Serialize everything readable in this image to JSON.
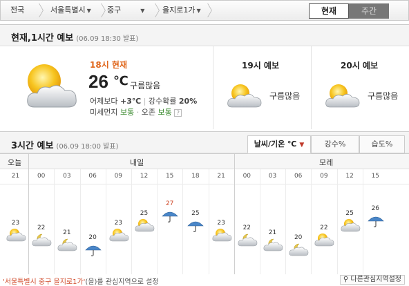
{
  "nav": {
    "country": "전국",
    "city": "서울특별시",
    "district": "중구",
    "dong": "을지로1가",
    "tab_now": "현재",
    "tab_week": "주간"
  },
  "now_section": {
    "title": "현재,1시간 예보",
    "timestamp": "(06.09 18:30 발표)",
    "current": {
      "label": "18시 현재",
      "temp": "26",
      "unit": "℃",
      "condition": "구름많음",
      "compare_label": "어제보다",
      "compare_value": "+3℃",
      "precip_label": "강수확률",
      "precip_value": "20%",
      "dust_label": "미세먼지",
      "dust_value": "보통",
      "ozone_label": "오존",
      "ozone_value": "보통",
      "help": "?"
    },
    "forecasts": [
      {
        "title": "19시 예보",
        "condition": "구름많음",
        "icon": "partly-cloudy-sun-icon"
      },
      {
        "title": "20시 예보",
        "condition": "구름많음",
        "icon": "partly-cloudy-sun-icon"
      }
    ]
  },
  "three_hour": {
    "title": "3시간 예보",
    "timestamp": "(06.09 18:00 발표)",
    "tabs": [
      "날씨/기온 ℃",
      "강수%",
      "습도%"
    ],
    "days": [
      "오늘",
      "내일",
      "모레"
    ],
    "hours": [
      "21",
      "00",
      "03",
      "06",
      "09",
      "12",
      "15",
      "18",
      "21",
      "00",
      "03",
      "06",
      "09",
      "12",
      "15"
    ],
    "temps": [
      23,
      22,
      21,
      20,
      23,
      25,
      27,
      25,
      23,
      22,
      21,
      20,
      22,
      25,
      26
    ],
    "icons": [
      "cloud-sun",
      "cloud-moon",
      "cloud-moon",
      "rain",
      "cloud-sun",
      "cloud-sun",
      "rain",
      "rain",
      "cloud-sun",
      "cloud-moon",
      "cloud-moon",
      "cloud-moon",
      "cloud-sun",
      "cloud-sun",
      "rain"
    ]
  },
  "footer": {
    "location": "'서울특별시 중구 을지로1가'",
    "text": "(을)를 관심지역으로 설정",
    "button": "다른관심지역설정"
  },
  "colors": {
    "accent": "#e0661b",
    "good": "#3a8a2e",
    "high_temp": "#d04a2a"
  }
}
